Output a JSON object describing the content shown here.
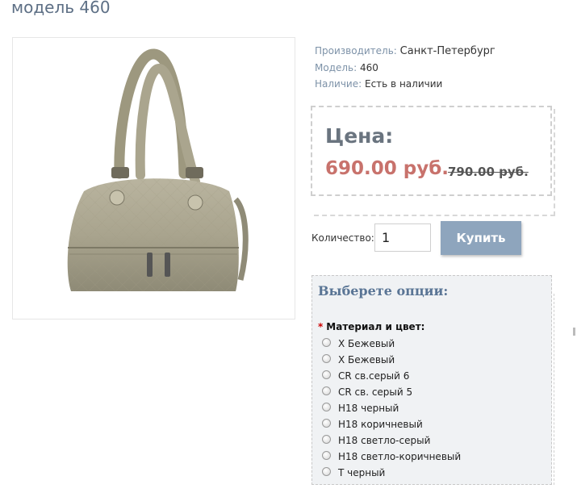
{
  "product": {
    "title": "модель 460",
    "maker_label": "Производитель:",
    "maker_value": "Санкт-Петербург",
    "model_label": "Модель:",
    "model_value": "460",
    "availability_label": "Наличие:",
    "availability_value": "Есть в наличии"
  },
  "price": {
    "label": "Цена:",
    "current": "690.00 руб.",
    "old": "790.00 руб."
  },
  "cart": {
    "quantity_label": "Количество:",
    "quantity_value": "1",
    "buy_label": "Купить"
  },
  "options": {
    "title": "Выберете опции:",
    "group_label": "Материал и цвет:",
    "required_mark": "*",
    "items": [
      {
        "label": "Х Бежевый"
      },
      {
        "label": "Х Бежевый"
      },
      {
        "label": "CR св.серый 6"
      },
      {
        "label": "CR св. серый 5"
      },
      {
        "label": "Н18 черный"
      },
      {
        "label": "Н18 коричневый"
      },
      {
        "label": "Н18 светло-серый"
      },
      {
        "label": "Н18 светло-коричневый"
      },
      {
        "label": "Т черный"
      }
    ]
  },
  "colors": {
    "title": "#5d6f85",
    "price_new": "#c8726c",
    "buy_button": "#8ea5bd",
    "options_bg": "#f0f2f4"
  }
}
